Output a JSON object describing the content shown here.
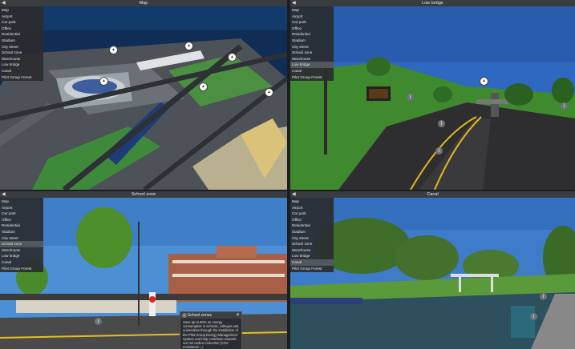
{
  "menu_items": [
    "Map",
    "Airport",
    "Car park",
    "Office",
    "Residential",
    "Stadium",
    "City street",
    "School zone",
    "Warehouse",
    "Low bridge",
    "Canal",
    "Pilot Group Forest"
  ],
  "panes": {
    "map": {
      "title": "Map",
      "active_item": ""
    },
    "bridge": {
      "title": "Low bridge",
      "active_item": "Low bridge"
    },
    "school": {
      "title": "School zone",
      "active_item": "School zone"
    },
    "canal": {
      "title": "Canal",
      "active_item": "Canal"
    }
  },
  "collapse_glyph": "◀",
  "icons": {
    "info": "info-icon",
    "pin": "location-pin-icon",
    "close": "close-icon"
  },
  "popup": {
    "title": "School zones",
    "close": "✕",
    "body": "Save up to 80% on energy consumption in schools, colleges and universities through the installation of the Pilot Group Energy Management System and help contribute towards our net carbon reduction (CO2 emissions/...)"
  },
  "colors": {
    "sky": "#2f6db8",
    "grass": "#3f8a36",
    "road": "#3a3a3c",
    "titlebar": "#3a3d40"
  }
}
